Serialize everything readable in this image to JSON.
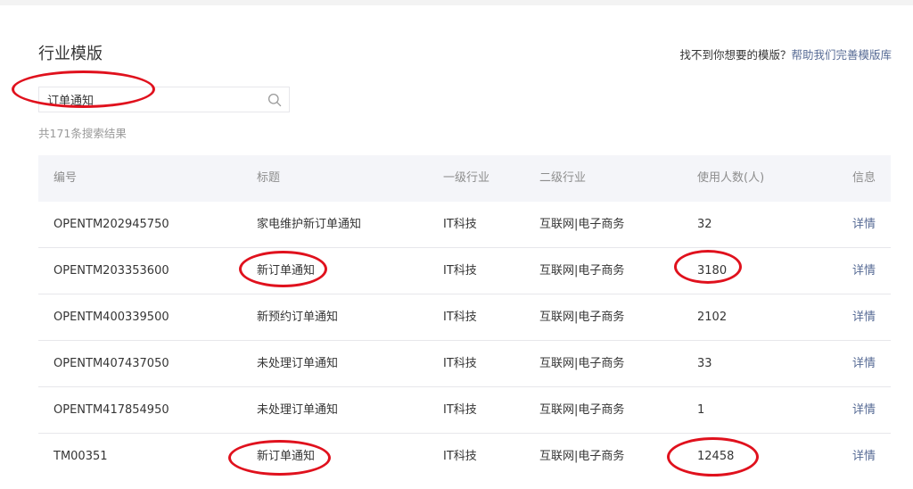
{
  "page": {
    "title": "行业模版",
    "help_text": "找不到你想要的模版？",
    "help_link": "帮助我们完善模版库"
  },
  "search": {
    "value": "订单通知",
    "icon": "search-icon"
  },
  "result_count": "共171条搜索结果",
  "table": {
    "headers": [
      "编号",
      "标题",
      "一级行业",
      "二级行业",
      "使用人数(人)",
      "信息"
    ],
    "rows": [
      {
        "id": "OPENTM202945750",
        "title": "家电维护新订单通知",
        "industry1": "IT科技",
        "industry2": "互联网|电子商务",
        "users": "32",
        "info": "详情"
      },
      {
        "id": "OPENTM203353600",
        "title": "新订单通知",
        "industry1": "IT科技",
        "industry2": "互联网|电子商务",
        "users": "3180",
        "info": "详情"
      },
      {
        "id": "OPENTM400339500",
        "title": "新预约订单通知",
        "industry1": "IT科技",
        "industry2": "互联网|电子商务",
        "users": "2102",
        "info": "详情"
      },
      {
        "id": "OPENTM407437050",
        "title": "未处理订单通知",
        "industry1": "IT科技",
        "industry2": "互联网|电子商务",
        "users": "33",
        "info": "详情"
      },
      {
        "id": "OPENTM417854950",
        "title": "未处理订单通知",
        "industry1": "IT科技",
        "industry2": "互联网|电子商务",
        "users": "1",
        "info": "详情"
      },
      {
        "id": "TM00351",
        "title": "新订单通知",
        "industry1": "IT科技",
        "industry2": "互联网|电子商务",
        "users": "12458",
        "info": "详情"
      }
    ]
  },
  "colors": {
    "link": "#576b95",
    "annotation": "#e0111d",
    "header_bg": "#f4f5f9"
  }
}
